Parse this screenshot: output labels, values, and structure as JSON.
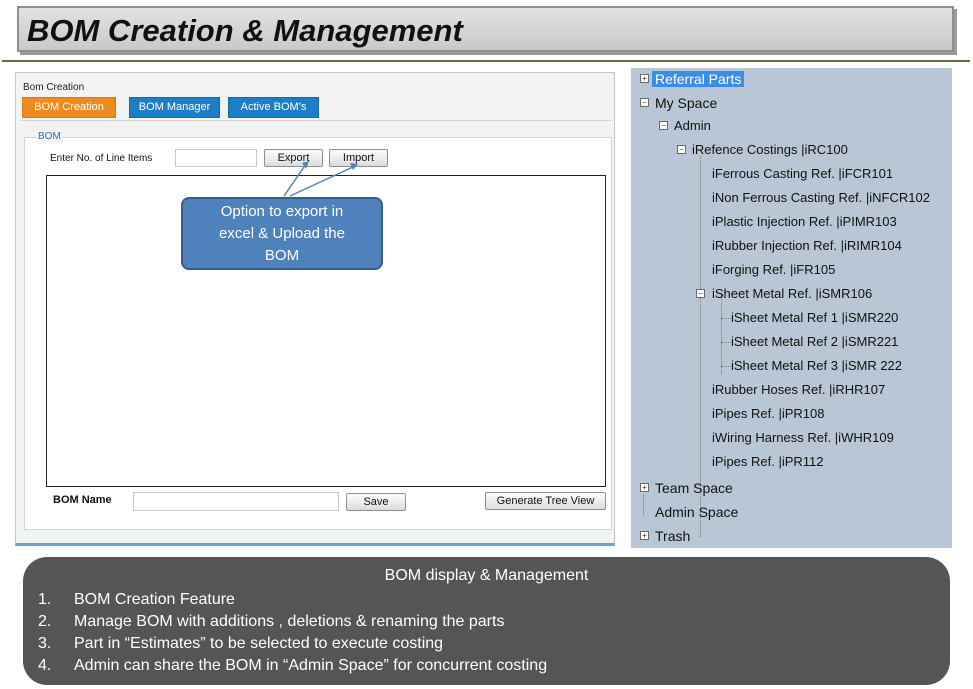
{
  "slide_title": "BOM Creation & Management",
  "app": {
    "window_title": "Bom Creation",
    "tabs": [
      {
        "label": "BOM Creation",
        "active": true
      },
      {
        "label": "BOM Manager",
        "active": false
      },
      {
        "label": "Active BOM's",
        "active": false
      }
    ],
    "group_legend": "BOM",
    "line_items_label": "Enter No. of Line Items",
    "line_items_value": "",
    "export_label": "Export",
    "import_label": "Import",
    "bom_name_label": "BOM Name",
    "bom_name_value": "",
    "save_label": "Save",
    "generate_label": "Generate Tree View"
  },
  "callout": {
    "line1": "Option to export in",
    "line2": "excel & Upload the",
    "line3": "BOM"
  },
  "tree": {
    "referral_parts": "Referral Parts",
    "my_space": "My Space",
    "admin": "Admin",
    "reference_costings": "iRefence Costings |iRC100",
    "items": [
      "iFerrous Casting Ref. |iFCR101",
      "iNon Ferrous Casting Ref.  |iNFCR102",
      "iPlastic Injection Ref. |iPIMR103",
      "iRubber Injection Ref. |iRIMR104",
      "iForging Ref. |iFR105",
      "iSheet Metal Ref. |iSMR106",
      "iRubber Hoses Ref. |iRHR107",
      "iPipes Ref. |iPR108",
      "iWiring Harness Ref. |iWHR109",
      "iPipes Ref. |iPR112"
    ],
    "sheet_metal_children": [
      "iSheet Metal Ref 1 |iSMR220",
      "iSheet Metal Ref 2 |iSMR221",
      "iSheet Metal Ref 3 |iSMR 222"
    ],
    "team_space": "Team Space",
    "admin_space": "Admin Space",
    "trash": "Trash"
  },
  "summary": {
    "title": "BOM display & Management",
    "items": [
      {
        "num": "1.",
        "text": "BOM Creation Feature"
      },
      {
        "num": "2.",
        "text": "Manage BOM with additions , deletions & renaming the parts"
      },
      {
        "num": "3.",
        "text": "Part in “Estimates” to be selected  to execute costing"
      },
      {
        "num": "4.",
        "text": "Admin can share the BOM in “Admin Space” for concurrent costing"
      }
    ]
  },
  "colors": {
    "active_tab": "#ee8b1f",
    "tab": "#1c7fc5",
    "callout": "#4f81bd",
    "tree_bg": "#b9c6d6",
    "tree_highlight": "#3b8ee8",
    "summary_bg": "#555555"
  }
}
